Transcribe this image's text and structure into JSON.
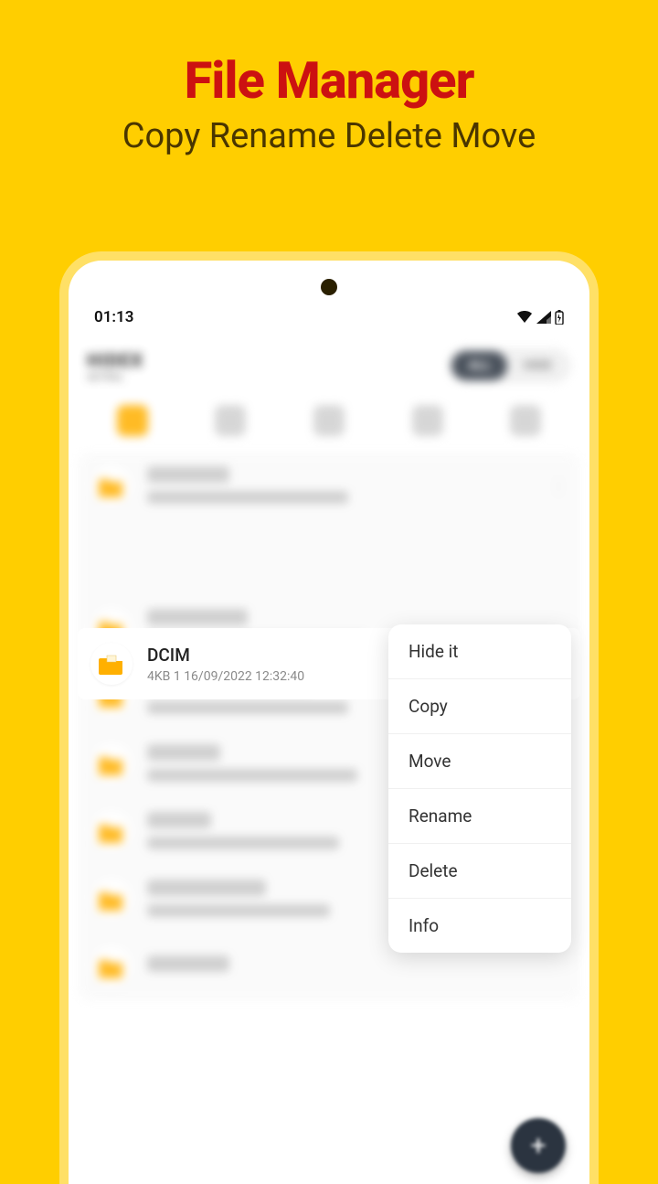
{
  "promo": {
    "title": "File Manager",
    "subtitle": "Copy Rename Delete Move"
  },
  "status": {
    "time": "01:13"
  },
  "header": {
    "logo_main": "HIDEX",
    "logo_sub": "AETRAL",
    "seg_all": "ALL",
    "seg_hide": "HIDE"
  },
  "focused_file": {
    "name": "DCIM",
    "meta": "4KB  1  16/09/2022 12:32:40"
  },
  "blurred_files": [
    {
      "name": "Android"
    },
    {
      "name": "Download"
    },
    {
      "name": "EditedOnlinePhotos"
    },
    {
      "name": "Movies"
    },
    {
      "name": "Music"
    },
    {
      "name": "Notifications"
    },
    {
      "name": "Pictures"
    }
  ],
  "context_menu": [
    "Hide it",
    "Copy",
    "Move",
    "Rename",
    "Delete",
    "Info"
  ],
  "fab": "+"
}
